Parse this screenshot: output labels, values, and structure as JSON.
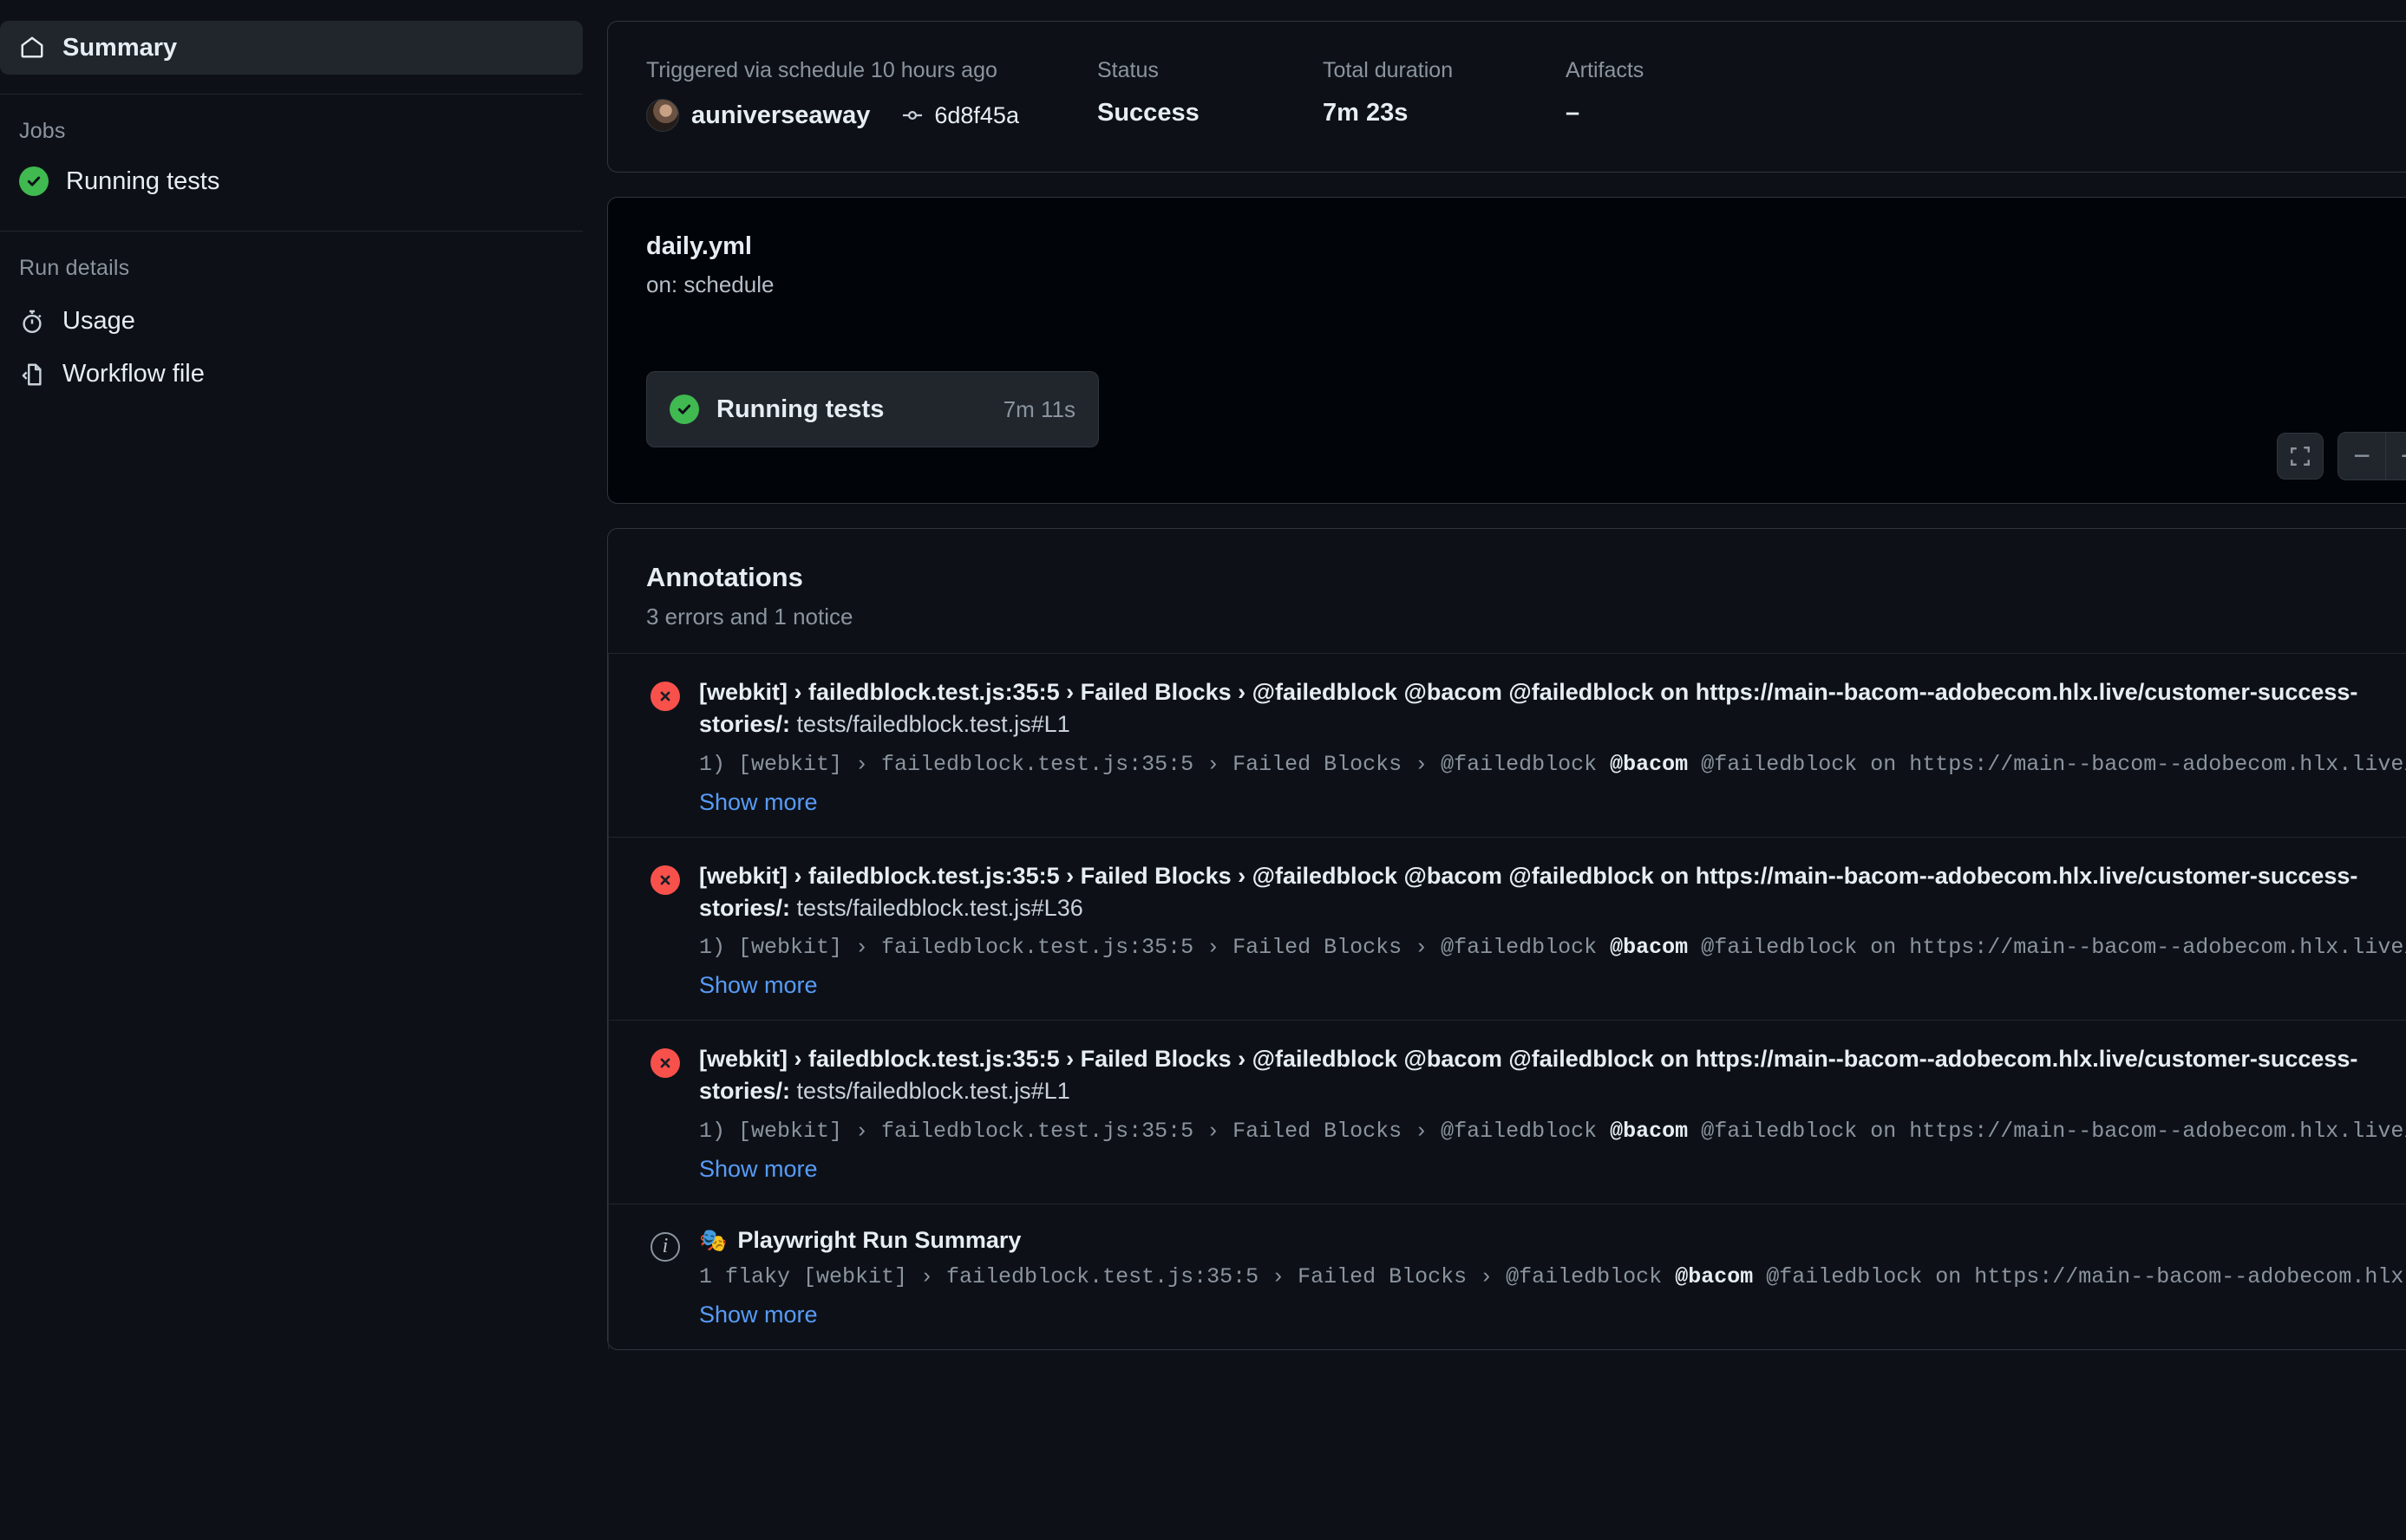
{
  "sidebar": {
    "summary": {
      "label": "Summary",
      "icon": "home-icon"
    },
    "jobs_group_label": "Jobs",
    "job": {
      "label": "Running tests",
      "status_icon": "success-check-icon"
    },
    "run_details_group_label": "Run details",
    "links": [
      {
        "label": "Usage",
        "icon": "stopwatch-icon"
      },
      {
        "label": "Workflow file",
        "icon": "file-code-icon"
      }
    ]
  },
  "run_meta": {
    "trigger_label": "Triggered via schedule 10 hours ago",
    "actor": "auniverseaway",
    "commit_sha": "6d8f45a",
    "status_label": "Status",
    "status_value": "Success",
    "duration_label": "Total duration",
    "duration_value": "7m 23s",
    "artifacts_label": "Artifacts",
    "artifacts_value": "–"
  },
  "graph": {
    "workflow_file": "daily.yml",
    "trigger": "on: schedule",
    "job_label": "Running tests",
    "job_duration": "7m 11s",
    "controls": {
      "fit_label": "fit-to-screen",
      "zoom_out_label": "−",
      "zoom_in_label": "+"
    }
  },
  "annotations": {
    "title": "Annotations",
    "summary": "3 errors and 1 notice",
    "show_more_label": "Show more",
    "items": [
      {
        "type": "error",
        "icon": "error-x-icon",
        "heading": "[webkit] › failedblock.test.js:35:5 › Failed Blocks › @failedblock @bacom @failedblock on https://main--bacom--adobecom.hlx.live/customer-success-stories/:",
        "location": "tests/failedblock.test.js#L1",
        "raw_prefix": "1) [webkit] › failedblock.test.js:35:5 › Failed Blocks › @failedblock ",
        "raw_bold": "@bacom",
        "raw_suffix": " @failedblock on https://main--bacom--adobecom.hlx.live/…"
      },
      {
        "type": "error",
        "icon": "error-x-icon",
        "heading": "[webkit] › failedblock.test.js:35:5 › Failed Blocks › @failedblock @bacom @failedblock on https://main--bacom--adobecom.hlx.live/customer-success-stories/:",
        "location": "tests/failedblock.test.js#L36",
        "raw_prefix": "1) [webkit] › failedblock.test.js:35:5 › Failed Blocks › @failedblock ",
        "raw_bold": "@bacom",
        "raw_suffix": " @failedblock on https://main--bacom--adobecom.hlx.live/…"
      },
      {
        "type": "error",
        "icon": "error-x-icon",
        "heading": "[webkit] › failedblock.test.js:35:5 › Failed Blocks › @failedblock @bacom @failedblock on https://main--bacom--adobecom.hlx.live/customer-success-stories/:",
        "location": "tests/failedblock.test.js#L1",
        "raw_prefix": "1) [webkit] › failedblock.test.js:35:5 › Failed Blocks › @failedblock ",
        "raw_bold": "@bacom",
        "raw_suffix": " @failedblock on https://main--bacom--adobecom.hlx.live/…"
      },
      {
        "type": "notice",
        "icon": "info-icon",
        "emoji": "🎭",
        "heading": "Playwright Run Summary",
        "location": "",
        "raw_prefix": "1 flaky [webkit] › failedblock.test.js:35:5 › Failed Blocks › @failedblock ",
        "raw_bold": "@bacom",
        "raw_suffix": " @failedblock on https://main--bacom--adobecom.hlx.…"
      }
    ]
  },
  "colors": {
    "page_bg": "#0d1117",
    "card_border": "#30363d",
    "success_green": "#3fb950",
    "error_red": "#f8514c",
    "link_blue": "#589bf8",
    "accent_blue": "#5a9cf8",
    "muted_text": "#8b949e"
  }
}
